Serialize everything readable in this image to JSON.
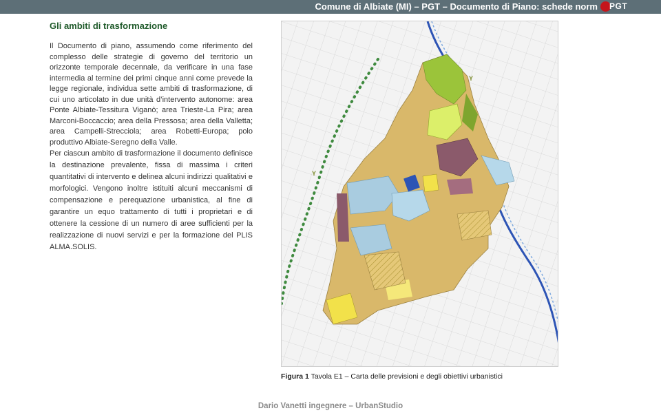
{
  "header": {
    "title": "Comune di Albiate (MI) – PGT – Documento di Piano: schede norm",
    "logo_text": "PGT"
  },
  "section": {
    "heading": "Gli ambiti di trasformazione",
    "paragraph_1": "Il Documento di piano, assumendo come riferimento del complesso delle strategie di governo del territorio un orizzonte temporale decennale, da verificare in una fase intermedia al termine dei primi cinque anni come prevede la legge regionale, individua sette ambiti di trasformazione, di cui uno articolato in due unità d’intervento autonome: area Ponte Albiate-Tessitura Viganò; area Trieste-La Pira; area Marconi-Boccaccio; area della Pressosa; area della Valletta; area Campelli-Strecciola; area Robetti-Europa; polo produttivo Albiate-Seregno della Valle.",
    "paragraph_2": "Per ciascun ambito di trasformazione il documento definisce la destinazione prevalente, fissa di massima i criteri quantitativi di intervento e delinea alcuni indirizzi qualitativi e morfologici. Vengono inoltre istituiti alcuni meccanismi di compensazione e perequazione urbanistica, al fine di garantire un equo trattamento di tutti i proprietari e di ottenere la cessione di un numero di aree sufficienti per la realizzazione di nuovi servizi e per la formazione del PLIS ALMA.SOLIS."
  },
  "figure": {
    "label": "Figura 1",
    "caption": " Tavola E1 – Carta delle previsioni e degli obiettivi urbanistici",
    "colors": {
      "residential": "#d9b86a",
      "industrial": "#a9cce0",
      "historic_center": "#8b5a6b",
      "green": "#9bc43a",
      "service": "#f2e14a",
      "river": "#2d54b5",
      "ecological_corridor": "#3f8a3f"
    }
  },
  "footer": {
    "text": "Dario Vanetti ingegnere – UrbanStudio"
  }
}
